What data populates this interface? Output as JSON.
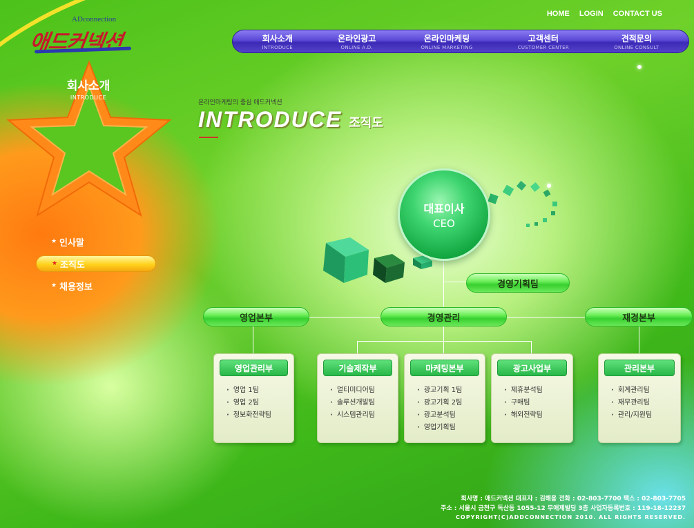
{
  "logo": {
    "sub": "ADconnection",
    "main": "애드커넥션"
  },
  "top_links": [
    "HOME",
    "LOGIN",
    "CONTACT US"
  ],
  "gnb": [
    {
      "ko": "회사소개",
      "en": "INTRODUCE"
    },
    {
      "ko": "온라인광고",
      "en": "ONLINE A.D."
    },
    {
      "ko": "온라인마케팅",
      "en": "ONLINE MARKETING"
    },
    {
      "ko": "고객센터",
      "en": "CUSTOMER CENTER"
    },
    {
      "ko": "견적문의",
      "en": "ONLINE CONSULT"
    }
  ],
  "section": {
    "ko": "회사소개",
    "en": "INTRODUCE"
  },
  "lnb": [
    {
      "label": "인사말",
      "active": false
    },
    {
      "label": "조직도",
      "active": true
    },
    {
      "label": "채용정보",
      "active": false
    }
  ],
  "header": {
    "kicker": "온라인마케팅의 중심 애드커넥션",
    "title_en": "INTRODUCE",
    "title_ko": "조직도"
  },
  "org": {
    "ceo": {
      "ko": "대표이사",
      "en": "CEO"
    },
    "planning": "경영기획팀",
    "divisions": [
      "영업본부",
      "경영관리",
      "재경본부"
    ],
    "departments": [
      {
        "title": "영업관리부",
        "teams": [
          "영업 1팀",
          "영업 2팀",
          "정보화전략팀"
        ]
      },
      {
        "title": "기술제작부",
        "teams": [
          "멀티미디어팀",
          "솔루션개발팀",
          "시스템관리팀"
        ]
      },
      {
        "title": "마케팅본부",
        "teams": [
          "광고기획 1팀",
          "광고기획 2팀",
          "광고분석팀",
          "영업기획팀"
        ]
      },
      {
        "title": "광고사업부",
        "teams": [
          "제휴분석팀",
          "구매팀",
          "해외전략팀"
        ]
      },
      {
        "title": "관리본부",
        "teams": [
          "회계관리팀",
          "재무관리팀",
          "관리/지원팀"
        ]
      }
    ]
  },
  "footer": {
    "line1": "회사명 : 애드커넥션     대표자 : 김해용     전화 : 02-803-7700     팩스 : 02-803-7705",
    "line2": "주소 : 서울시 금천구 독산동 1055-12 무애제빌딩 3층     사업자등록번호 : 119-18-12237",
    "line3": "COPYRIGHT(C)ADDCONNECTION 2010. ALL RIGHTS RESERVED."
  },
  "colors": {
    "accent_purple": "#5a48d6",
    "pill_green": "#38d030",
    "star_orange": "#ff8a1a"
  }
}
